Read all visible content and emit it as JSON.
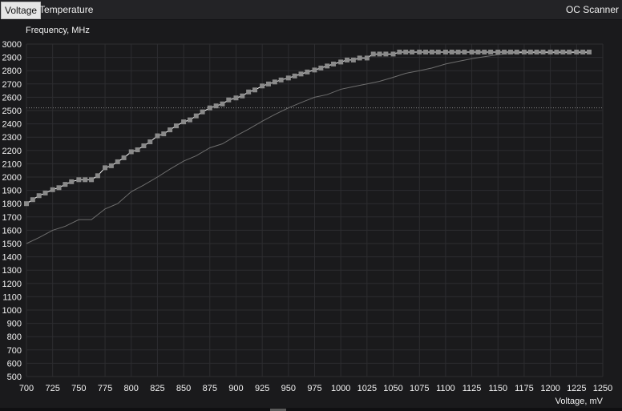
{
  "tabs": [
    {
      "label": "Voltage",
      "active": true
    },
    {
      "label": "Temperature",
      "active": false
    }
  ],
  "right_tab": {
    "label": "OC Scanner"
  },
  "colors": {
    "background": "#1a1a1c",
    "grid": "#2d2d30",
    "curve": "#ffffff",
    "points": "#8a8a8a",
    "baseline_curve": "#6e6e6e",
    "reference_line": "#888888"
  },
  "chart_data": {
    "type": "line",
    "xlabel": "Voltage, mV",
    "ylabel": "Frequency, MHz",
    "xlim": [
      700,
      1250
    ],
    "ylim": [
      500,
      3000
    ],
    "x_ticks": [
      700,
      725,
      750,
      775,
      800,
      825,
      850,
      875,
      900,
      925,
      950,
      975,
      1000,
      1025,
      1050,
      1075,
      1100,
      1125,
      1150,
      1175,
      1200,
      1225,
      1250
    ],
    "y_ticks": [
      500,
      600,
      700,
      800,
      900,
      1000,
      1100,
      1200,
      1300,
      1400,
      1500,
      1600,
      1700,
      1800,
      1900,
      2000,
      2100,
      2200,
      2300,
      2400,
      2500,
      2600,
      2700,
      2800,
      2900,
      3000
    ],
    "grid": true,
    "reference_line_y": 2520,
    "series": [
      {
        "role": "curve_points",
        "x": [
          700,
          706,
          712,
          718,
          725,
          731,
          737,
          743,
          750,
          756,
          762,
          768,
          775,
          781,
          787,
          793,
          800,
          806,
          812,
          818,
          825,
          831,
          837,
          843,
          850,
          856,
          862,
          868,
          875,
          881,
          887,
          893,
          900,
          906,
          912,
          918,
          925,
          931,
          937,
          943,
          950,
          956,
          962,
          968,
          975,
          981,
          987,
          993,
          1000,
          1006,
          1012,
          1018,
          1025,
          1031,
          1037,
          1043,
          1050,
          1056,
          1062,
          1068,
          1075,
          1081,
          1087,
          1093,
          1100,
          1106,
          1112,
          1118,
          1125,
          1131,
          1137,
          1143,
          1150,
          1156,
          1162,
          1168,
          1175,
          1181,
          1187,
          1193,
          1200,
          1206,
          1212,
          1218,
          1225,
          1231,
          1237
        ],
        "y": [
          1800,
          1830,
          1860,
          1880,
          1905,
          1920,
          1945,
          1965,
          1980,
          1980,
          1980,
          2010,
          2070,
          2085,
          2115,
          2145,
          2190,
          2205,
          2235,
          2265,
          2310,
          2325,
          2355,
          2385,
          2415,
          2430,
          2460,
          2490,
          2520,
          2535,
          2550,
          2580,
          2595,
          2610,
          2640,
          2655,
          2685,
          2700,
          2715,
          2730,
          2745,
          2760,
          2775,
          2790,
          2805,
          2820,
          2835,
          2850,
          2865,
          2880,
          2880,
          2895,
          2895,
          2925,
          2925,
          2925,
          2925,
          2940,
          2940,
          2940,
          2940,
          2940,
          2940,
          2940,
          2940,
          2940,
          2940,
          2940,
          2940,
          2940,
          2940,
          2940,
          2940,
          2940,
          2940,
          2940,
          2940,
          2940,
          2940,
          2940,
          2940,
          2940,
          2940,
          2940,
          2940,
          2940,
          2940
        ]
      },
      {
        "role": "baseline_curve",
        "x": [
          700,
          712,
          725,
          737,
          750,
          762,
          775,
          787,
          800,
          812,
          825,
          837,
          850,
          862,
          875,
          887,
          900,
          912,
          925,
          937,
          950,
          962,
          975,
          987,
          1000,
          1012,
          1025,
          1037,
          1050,
          1062,
          1075,
          1087,
          1100,
          1112,
          1125,
          1137,
          1150,
          1162,
          1175,
          1187,
          1200,
          1212,
          1225,
          1237
        ],
        "y": [
          1500,
          1545,
          1600,
          1630,
          1680,
          1680,
          1760,
          1800,
          1890,
          1940,
          2000,
          2060,
          2120,
          2160,
          2220,
          2250,
          2310,
          2360,
          2420,
          2470,
          2520,
          2560,
          2600,
          2620,
          2660,
          2680,
          2700,
          2720,
          2750,
          2780,
          2800,
          2820,
          2850,
          2870,
          2890,
          2905,
          2920,
          2930,
          2935,
          2935,
          2935,
          2935,
          2935,
          2935
        ]
      }
    ]
  }
}
